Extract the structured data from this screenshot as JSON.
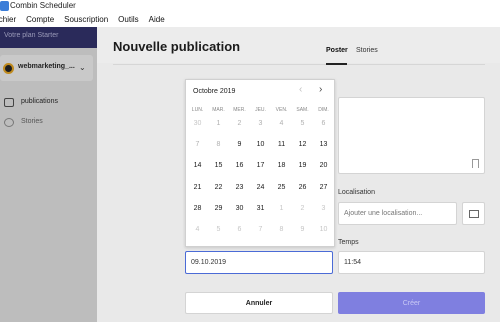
{
  "window": {
    "title": "Combin Scheduler"
  },
  "menu": [
    "ichier",
    "Compte",
    "Souscription",
    "Outils",
    "Aide"
  ],
  "sidebar": {
    "plan_text": "Votre plan Starter",
    "account_name": "webmarketing_...",
    "items": [
      {
        "label": "publications",
        "icon": "camera-icon"
      },
      {
        "label": "Stories",
        "icon": "stories-icon"
      }
    ]
  },
  "main": {
    "title": "Nouvelle publication",
    "tabs": [
      {
        "label": "Poster",
        "active": true
      },
      {
        "label": "Stories",
        "active": false
      }
    ],
    "location_label": "Localisation",
    "location_placeholder": "Ajouter une localisation...",
    "time_label": "Temps",
    "time_value": "11:54",
    "date_value": "09.10.2019",
    "cancel_label": "Annuler",
    "create_label": "Créer"
  },
  "datepicker": {
    "month_label": "Octobre 2019",
    "weekdays": [
      "LUN.",
      "MAR.",
      "MER.",
      "JEU.",
      "VEN.",
      "SAM.",
      "DIM."
    ],
    "weeks": [
      [
        "30",
        "1",
        "2",
        "3",
        "4",
        "5",
        "6"
      ],
      [
        "7",
        "8",
        "9",
        "10",
        "11",
        "12",
        "13"
      ],
      [
        "14",
        "15",
        "16",
        "17",
        "18",
        "19",
        "20"
      ],
      [
        "21",
        "22",
        "23",
        "24",
        "25",
        "26",
        "27"
      ],
      [
        "28",
        "29",
        "30",
        "31",
        "1",
        "2",
        "3"
      ],
      [
        "4",
        "5",
        "6",
        "7",
        "8",
        "9",
        "10"
      ]
    ],
    "day_states": [
      [
        "out",
        "past",
        "past",
        "past",
        "past",
        "past",
        "past"
      ],
      [
        "past",
        "past",
        "cur",
        "cur",
        "cur",
        "cur",
        "cur"
      ],
      [
        "cur",
        "cur",
        "cur",
        "cur",
        "cur",
        "cur",
        "cur"
      ],
      [
        "cur",
        "cur",
        "cur",
        "cur",
        "cur",
        "cur",
        "cur"
      ],
      [
        "cur",
        "cur",
        "cur",
        "cur",
        "out",
        "out",
        "out"
      ],
      [
        "out",
        "out",
        "out",
        "out",
        "out",
        "out",
        "out"
      ]
    ]
  },
  "colors": {
    "accent": "#7f7fe0",
    "plan_bar": "#2a2a5a",
    "overlay": "#bdbdbd"
  }
}
